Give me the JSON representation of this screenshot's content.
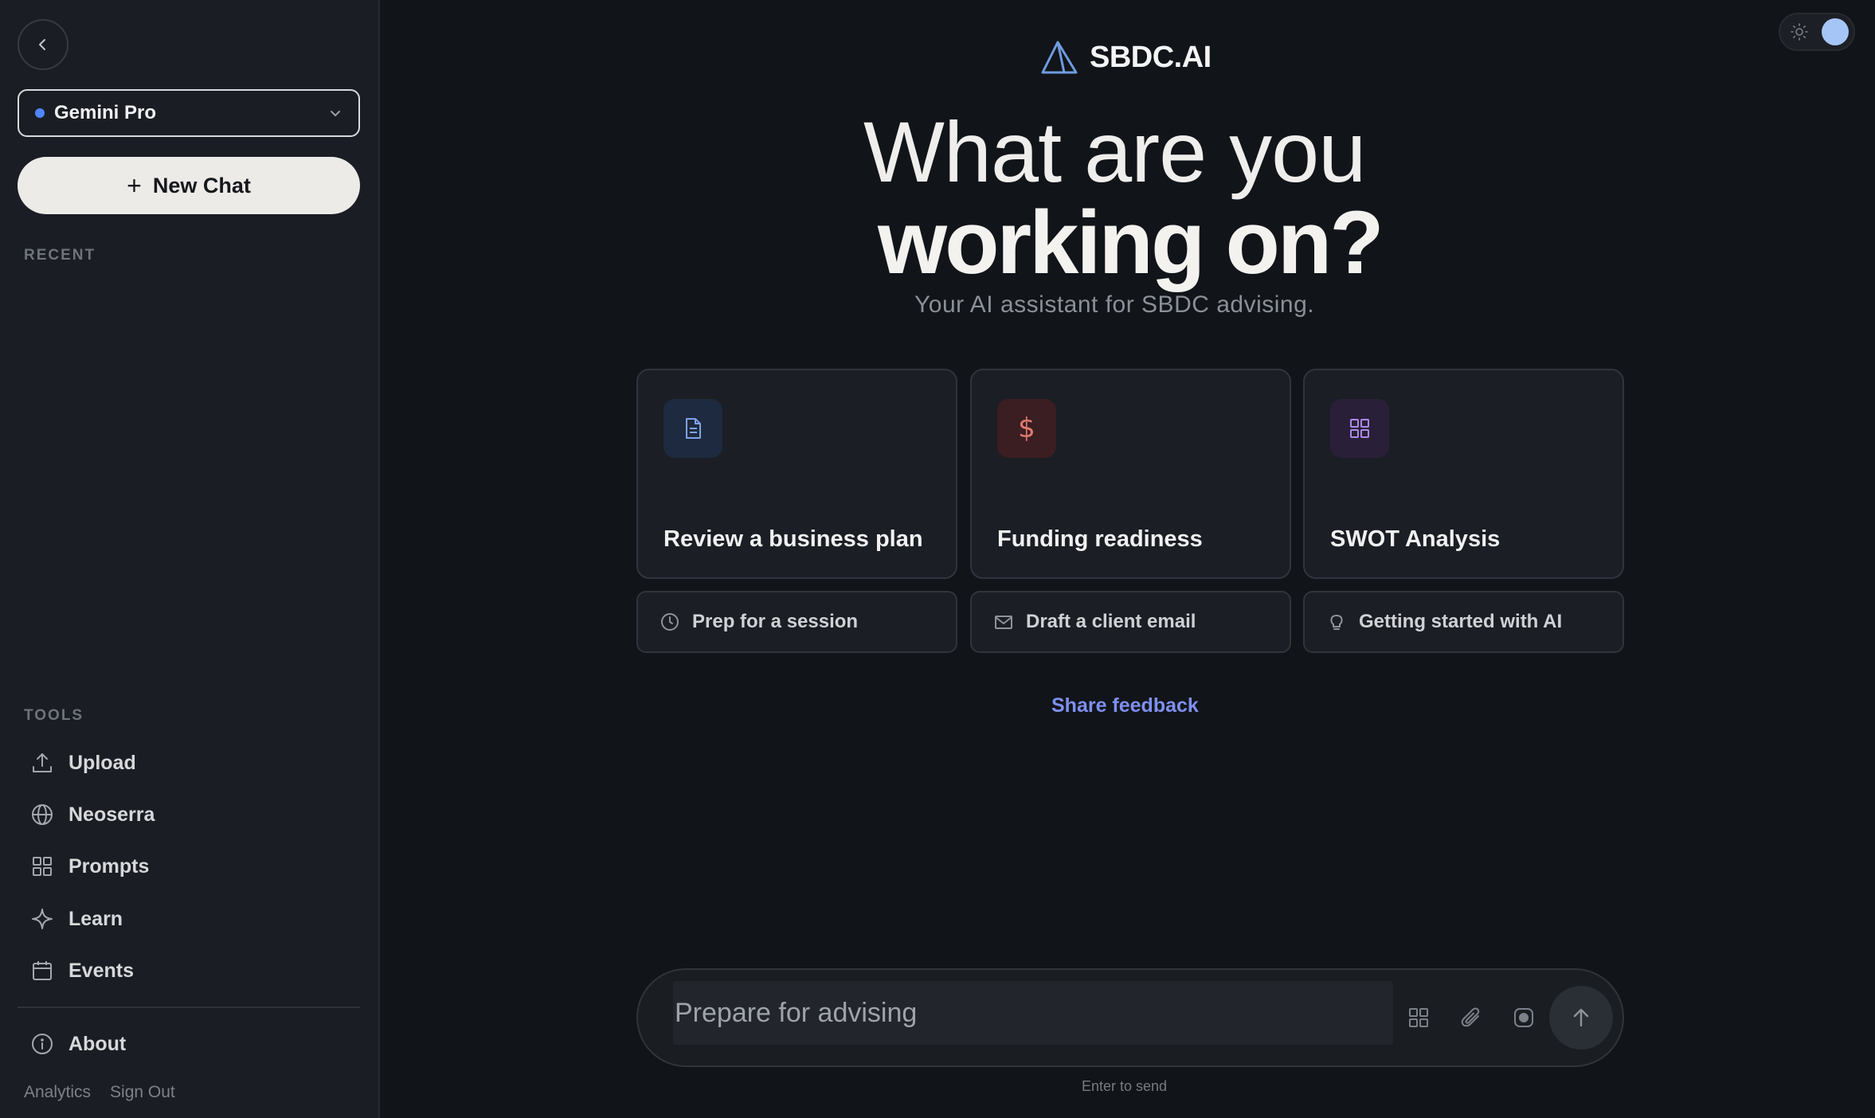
{
  "sidebar": {
    "model": {
      "label": "Gemini Pro",
      "indicator_color": "#4f86f7"
    },
    "new_chat_label": "New Chat",
    "recent_label": "RECENT",
    "tools_label": "TOOLS",
    "tools": [
      {
        "label": "Upload",
        "icon": "upload-icon"
      },
      {
        "label": "Neoserra",
        "icon": "globe-icon"
      },
      {
        "label": "Prompts",
        "icon": "grid-icon"
      },
      {
        "label": "Learn",
        "icon": "sparkle-icon"
      },
      {
        "label": "Events",
        "icon": "calendar-icon"
      }
    ],
    "about": {
      "label": "About",
      "icon": "info-icon"
    },
    "footer": {
      "analytics": "Analytics",
      "sign_out": "Sign Out"
    }
  },
  "brand": {
    "name": "SBDC.AI",
    "logo_icon": "triangle-logo-icon"
  },
  "hero": {
    "line1": "What are you",
    "line2": "working on?",
    "subtitle": "Your AI assistant for SBDC advising."
  },
  "cards": [
    {
      "title": "Review a business plan",
      "icon": "document-icon",
      "icon_bg": "#1e2a3f",
      "icon_color": "#7ea3e6"
    },
    {
      "title": "Funding readiness",
      "icon": "dollar-icon",
      "icon_bg": "#3a1e22",
      "icon_color": "#e07a6f"
    },
    {
      "title": "SWOT Analysis",
      "icon": "grid-icon",
      "icon_bg": "#2a1f38",
      "icon_color": "#a98ae6"
    }
  ],
  "chips": [
    {
      "label": "Prep for a session",
      "icon": "clock-icon"
    },
    {
      "label": "Draft a client email",
      "icon": "mail-icon"
    },
    {
      "label": "Getting started with AI",
      "icon": "lightbulb-icon"
    }
  ],
  "feedback_label": "Share feedback",
  "composer": {
    "placeholder": "Prepare for advising",
    "hint": "Enter to send"
  },
  "colors": {
    "accent_link": "#7e8ff0",
    "background": "#111418",
    "sidebar": "#1a1d23"
  }
}
